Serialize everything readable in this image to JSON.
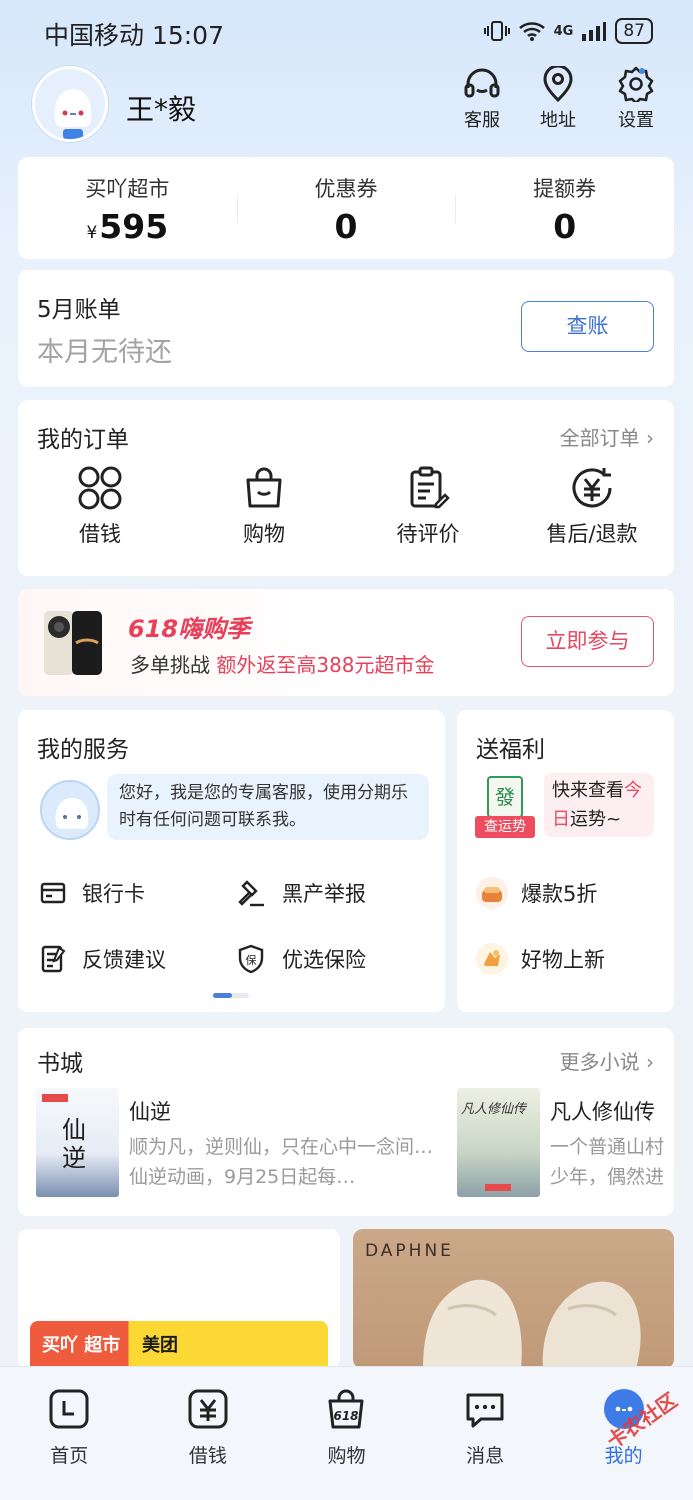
{
  "status": {
    "carrier_time": "中国移动 15:07",
    "network": "4G",
    "battery": "87"
  },
  "header": {
    "username": "王*毅",
    "actions": [
      {
        "label": "客服",
        "icon": "headset-icon"
      },
      {
        "label": "地址",
        "icon": "location-pin-icon"
      },
      {
        "label": "设置",
        "icon": "gear-icon"
      }
    ]
  },
  "stats": [
    {
      "label": "买吖超市",
      "currency": "¥",
      "value": "595"
    },
    {
      "label": "优惠券",
      "currency": "",
      "value": "0"
    },
    {
      "label": "提额券",
      "currency": "",
      "value": "0"
    }
  ],
  "bill": {
    "title": "5月账单",
    "subtitle": "本月无待还",
    "button": "查账"
  },
  "orders": {
    "title": "我的订单",
    "more": "全部订单 ›",
    "items": [
      {
        "label": "借钱",
        "icon": "four-petal-icon"
      },
      {
        "label": "购物",
        "icon": "shopping-bag-icon"
      },
      {
        "label": "待评价",
        "icon": "clipboard-edit-icon"
      },
      {
        "label": "售后/退款",
        "icon": "refund-yen-icon"
      }
    ]
  },
  "banner": {
    "title": "618嗨购季",
    "subtitle_plain": "多单挑战",
    "subtitle_highlight": "额外返至高388元超市金",
    "button": "立即参与"
  },
  "services": {
    "title": "我的服务",
    "message": "您好，我是您的专属客服，使用分期乐时有任何问题可联系我。",
    "items": [
      {
        "label": "银行卡",
        "icon": "bank-card-icon"
      },
      {
        "label": "黑产举报",
        "icon": "gavel-icon"
      },
      {
        "label": "反馈建议",
        "icon": "feedback-note-icon"
      },
      {
        "label": "优选保险",
        "icon": "insurance-shield-icon"
      }
    ]
  },
  "welfare": {
    "title": "送福利",
    "card_label": "查运势",
    "card_badge": "發",
    "promo_plain_1": "快来查看",
    "promo_highlight": "今日",
    "promo_plain_2": "运势~",
    "items": [
      {
        "label": "爆款5折",
        "icon": "hot-deal-icon"
      },
      {
        "label": "好物上新",
        "icon": "new-goods-icon"
      }
    ]
  },
  "books": {
    "title": "书城",
    "more": "更多小说 ›",
    "list": [
      {
        "title": "仙逆",
        "desc": "顺为凡，逆则仙，只在心中一念间…仙逆动画，9月25日起每…",
        "cover_text": "仙逆"
      },
      {
        "title": "凡人修仙传",
        "desc": "一个普通山村少年，偶然进入到当地江湖…",
        "cover_text": "凡人修仙传"
      }
    ]
  },
  "promos": {
    "left_a": "买吖 超市",
    "left_b": "美团",
    "right_brand": "DAPHNE"
  },
  "tabs": [
    {
      "label": "首页",
      "icon": "home-icon",
      "active": false
    },
    {
      "label": "借钱",
      "icon": "yen-box-icon",
      "active": false
    },
    {
      "label": "购物",
      "icon": "618-bag-icon",
      "active": false
    },
    {
      "label": "消息",
      "icon": "chat-bubble-icon",
      "active": false
    },
    {
      "label": "我的",
      "icon": "profile-face-icon",
      "active": true
    }
  ],
  "watermark": "卡农社区",
  "colors": {
    "accent_blue": "#3c72d4",
    "promo_red": "#e8405a",
    "tab_active": "#2f6fe2"
  }
}
